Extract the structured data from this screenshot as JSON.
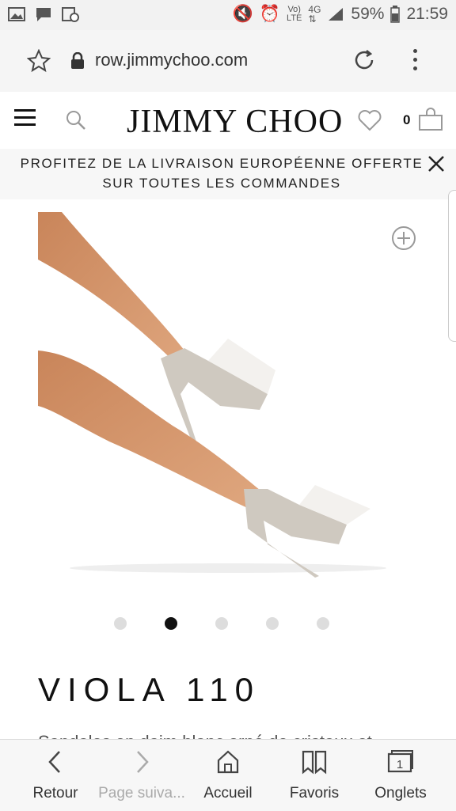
{
  "status_bar": {
    "icons_left": [
      "gallery-icon",
      "message-icon",
      "image-clock-icon"
    ],
    "icons_right": [
      "mute-icon",
      "alarm-icon",
      "volte-icon",
      "4g-icon",
      "signal-icon"
    ],
    "battery": "59%",
    "time": "21:59"
  },
  "browser": {
    "url": "row.jimmychoo.com"
  },
  "header": {
    "brand": "JIMMY CHOO",
    "cart_count": "0"
  },
  "promo": {
    "text": "PROFITEZ DE LA LIVRAISON EUROPÉENNE OFFERTE SUR TOUTES LES COMMANDES"
  },
  "product": {
    "name": "VIOLA 110",
    "description": "Sandales en daim blanc orné de cristaux et",
    "carousel": {
      "count": 5,
      "active_index": 1
    }
  },
  "bottom_nav": [
    {
      "label": "Retour",
      "icon": "chevron-left-icon"
    },
    {
      "label": "Page suiva...",
      "icon": "chevron-right-icon"
    },
    {
      "label": "Accueil",
      "icon": "home-icon"
    },
    {
      "label": "Favoris",
      "icon": "bookmarks-icon"
    },
    {
      "label": "Onglets",
      "icon": "tabs-icon",
      "badge": "1"
    }
  ],
  "colors": {
    "accent": "#111111",
    "bar_bg": "#f5f5f5"
  }
}
